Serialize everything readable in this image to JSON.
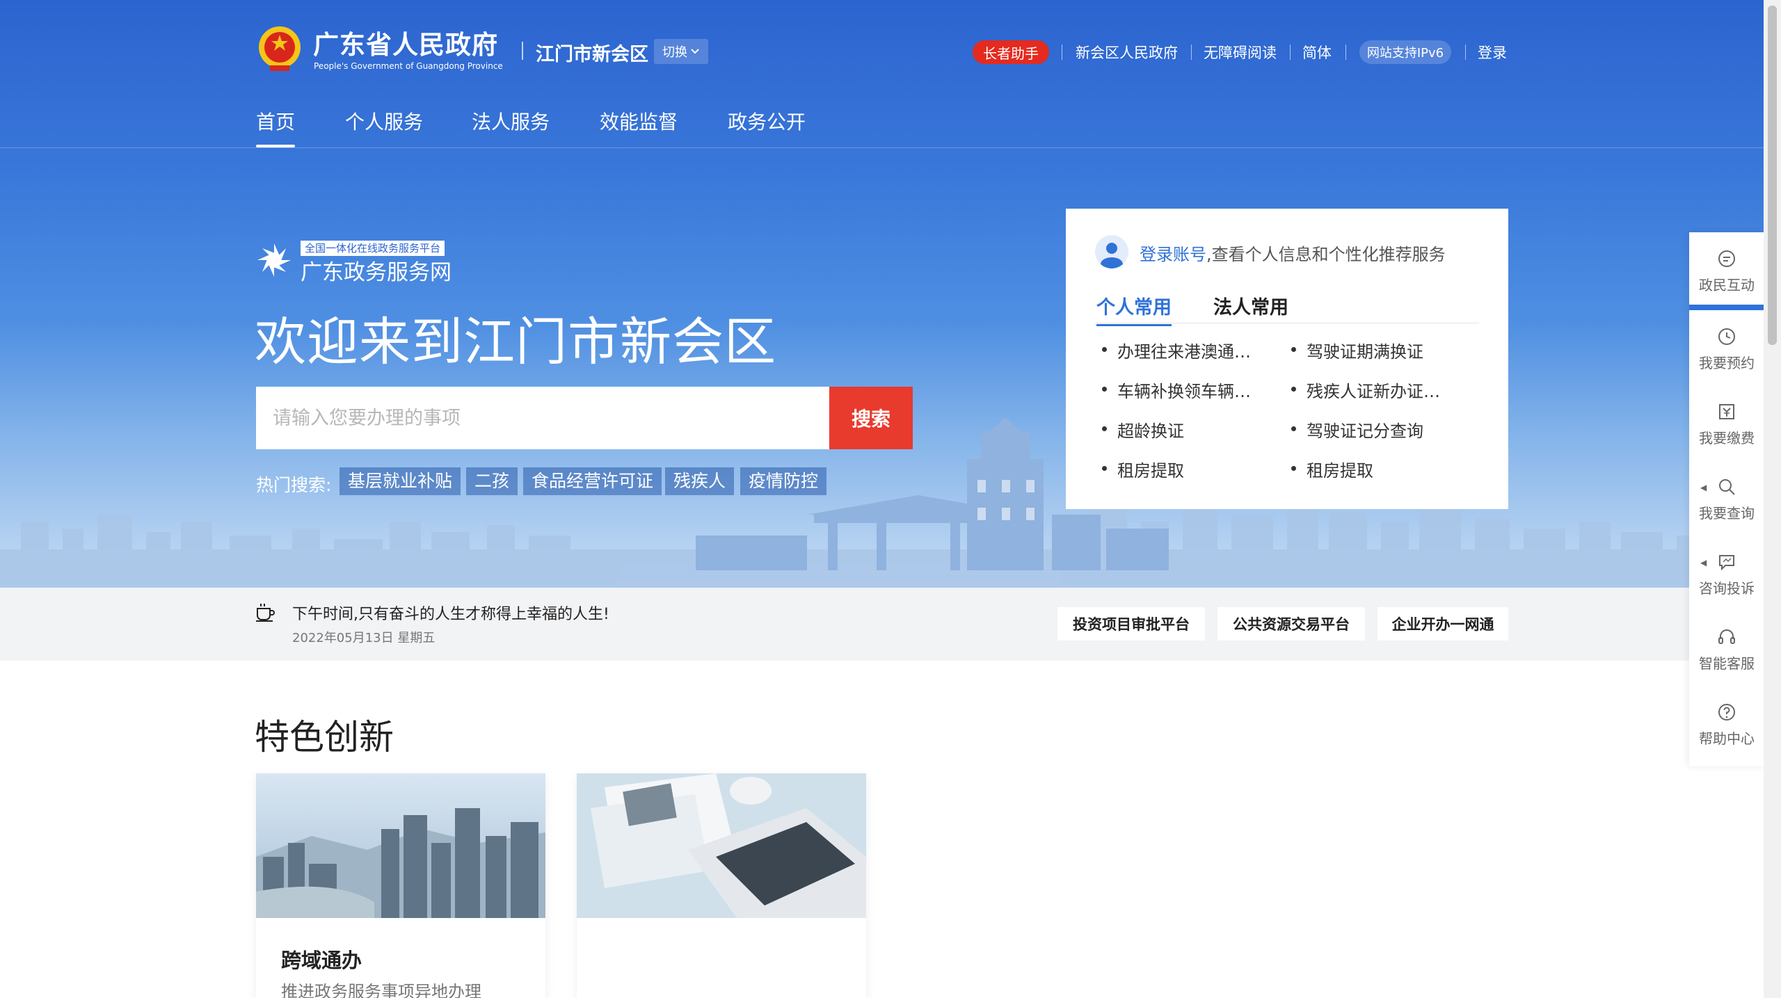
{
  "header": {
    "gov_title": "广东省人民政府",
    "gov_subtitle": "People's Government of Guangdong Province",
    "region": "江门市新会区",
    "switch_label": "切换",
    "elder_label": "长者助手",
    "links": [
      "新会区人民政府",
      "无障碍阅读",
      "简体"
    ],
    "ipv6_label": "网站支持IPv6",
    "login_label": "登录"
  },
  "nav": {
    "items": [
      "首页",
      "个人服务",
      "法人服务",
      "效能监督",
      "政务公开"
    ],
    "active_index": 0
  },
  "hero": {
    "platform_tag": "全国一体化在线政务服务平台",
    "platform_name": "广东政务服务网",
    "welcome": "欢迎来到江门市新会区",
    "search_placeholder": "请输入您要办理的事项",
    "search_button": "搜索",
    "hot_label": "热门搜索:",
    "hot_tags": [
      "基层就业补贴",
      "二孩",
      "食品经营许可证",
      "残疾人",
      "疫情防控"
    ]
  },
  "panel": {
    "login_link": "登录账号",
    "login_rest": ",查看个人信息和个性化推荐服务",
    "tabs": [
      "个人常用",
      "法人常用"
    ],
    "services": [
      "办理往来港澳通行证",
      "驾驶证期满换证",
      "车辆补换领车辆行驶证",
      "残疾人证新办证申请",
      "超龄换证",
      "驾驶证记分查询",
      "租房提取",
      "租房提取"
    ]
  },
  "infobar": {
    "greeting": "下午时间,只有奋斗的人生才称得上幸福的人生!",
    "date": "2022年05月13日 星期五",
    "quick_links": [
      "投资项目审批平台",
      "公共资源交易平台",
      "企业开办一网通"
    ]
  },
  "feature": {
    "title": "特色创新",
    "cards": [
      {
        "title": "跨域通办",
        "desc": "推进政务服务事项异地办理"
      },
      {
        "title": "",
        "desc": ""
      }
    ]
  },
  "float_bar": {
    "items": [
      "政民互动",
      "我要预约",
      "我要缴费",
      "我要查询",
      "咨询投诉",
      "智能客服",
      "帮助中心"
    ]
  },
  "colors": {
    "primary_blue": "#2c64cf",
    "accent_red": "#e83a2d",
    "link_blue": "#2f72d8"
  }
}
